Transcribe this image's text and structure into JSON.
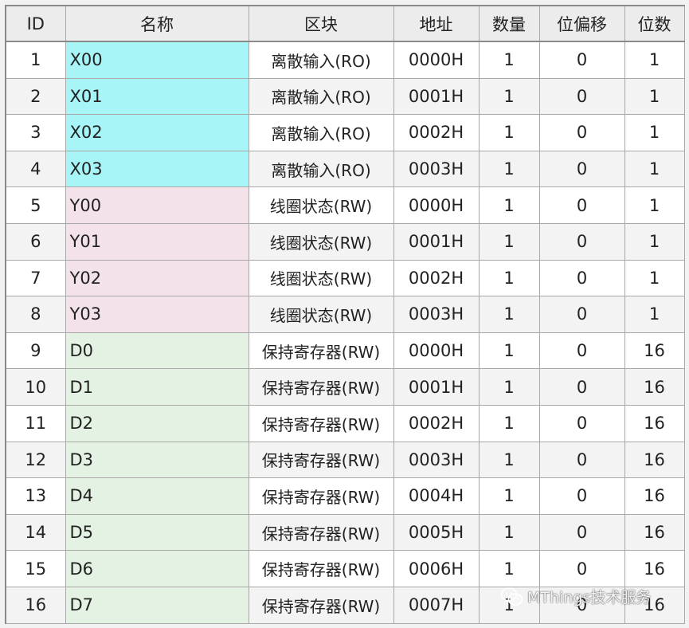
{
  "columns": [
    "ID",
    "名称",
    "区块",
    "地址",
    "数量",
    "位偏移",
    "位数"
  ],
  "colors": {
    "X": "#a8f5f7",
    "Y": "#f4e2ea",
    "D": "#e3f2e3"
  },
  "rows": [
    {
      "id": "1",
      "name": "X00",
      "group": "X",
      "block": "离散输入(RO)",
      "address": "0000H",
      "count": "1",
      "bit_offset": "0",
      "bits": "1"
    },
    {
      "id": "2",
      "name": "X01",
      "group": "X",
      "block": "离散输入(RO)",
      "address": "0001H",
      "count": "1",
      "bit_offset": "0",
      "bits": "1"
    },
    {
      "id": "3",
      "name": "X02",
      "group": "X",
      "block": "离散输入(RO)",
      "address": "0002H",
      "count": "1",
      "bit_offset": "0",
      "bits": "1"
    },
    {
      "id": "4",
      "name": "X03",
      "group": "X",
      "block": "离散输入(RO)",
      "address": "0003H",
      "count": "1",
      "bit_offset": "0",
      "bits": "1"
    },
    {
      "id": "5",
      "name": "Y00",
      "group": "Y",
      "block": "线圈状态(RW)",
      "address": "0000H",
      "count": "1",
      "bit_offset": "0",
      "bits": "1"
    },
    {
      "id": "6",
      "name": "Y01",
      "group": "Y",
      "block": "线圈状态(RW)",
      "address": "0001H",
      "count": "1",
      "bit_offset": "0",
      "bits": "1"
    },
    {
      "id": "7",
      "name": "Y02",
      "group": "Y",
      "block": "线圈状态(RW)",
      "address": "0002H",
      "count": "1",
      "bit_offset": "0",
      "bits": "1"
    },
    {
      "id": "8",
      "name": "Y03",
      "group": "Y",
      "block": "线圈状态(RW)",
      "address": "0003H",
      "count": "1",
      "bit_offset": "0",
      "bits": "1"
    },
    {
      "id": "9",
      "name": "D0",
      "group": "D",
      "block": "保持寄存器(RW)",
      "address": "0000H",
      "count": "1",
      "bit_offset": "0",
      "bits": "16"
    },
    {
      "id": "10",
      "name": "D1",
      "group": "D",
      "block": "保持寄存器(RW)",
      "address": "0001H",
      "count": "1",
      "bit_offset": "0",
      "bits": "16"
    },
    {
      "id": "11",
      "name": "D2",
      "group": "D",
      "block": "保持寄存器(RW)",
      "address": "0002H",
      "count": "1",
      "bit_offset": "0",
      "bits": "16"
    },
    {
      "id": "12",
      "name": "D3",
      "group": "D",
      "block": "保持寄存器(RW)",
      "address": "0003H",
      "count": "1",
      "bit_offset": "0",
      "bits": "16"
    },
    {
      "id": "13",
      "name": "D4",
      "group": "D",
      "block": "保持寄存器(RW)",
      "address": "0004H",
      "count": "1",
      "bit_offset": "0",
      "bits": "16"
    },
    {
      "id": "14",
      "name": "D5",
      "group": "D",
      "block": "保持寄存器(RW)",
      "address": "0005H",
      "count": "1",
      "bit_offset": "0",
      "bits": "16"
    },
    {
      "id": "15",
      "name": "D6",
      "group": "D",
      "block": "保持寄存器(RW)",
      "address": "0006H",
      "count": "1",
      "bit_offset": "0",
      "bits": "16"
    },
    {
      "id": "16",
      "name": "D7",
      "group": "D",
      "block": "保持寄存器(RW)",
      "address": "0007H",
      "count": "1",
      "bit_offset": "0",
      "bits": "16"
    }
  ],
  "watermark": {
    "text": "MThings技术服务",
    "icon": "wechat-icon"
  }
}
